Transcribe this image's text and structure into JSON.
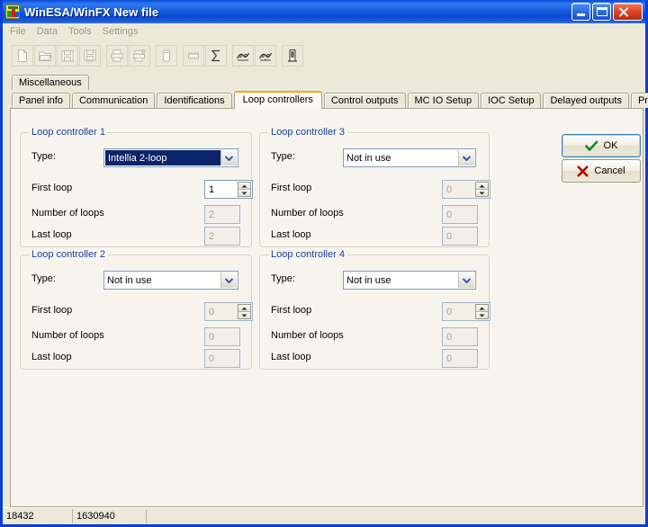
{
  "window": {
    "title": "WinESA/WinFX New file",
    "icon": "app-icon",
    "controls": {
      "minimize": "minimize-button",
      "maximize": "maximize-button",
      "close": "close-button"
    },
    "colors": {
      "titlebar_blue": "#0a49d6",
      "frame_blue": "#0a3fd4",
      "panel_bg": "#f7f4ee",
      "chrome_bg": "#ece9d8",
      "legend_blue": "#1b3f9c",
      "active_tab_accent": "#f5a623",
      "selection_blue": "#0a246a"
    }
  },
  "menubar": {
    "items": [
      {
        "label": "File"
      },
      {
        "label": "Data"
      },
      {
        "label": "Tools"
      },
      {
        "label": "Settings"
      }
    ]
  },
  "toolbar": {
    "buttons": [
      {
        "icon": "new-file-icon",
        "enabled": false
      },
      {
        "icon": "open-folder-icon",
        "enabled": false
      },
      {
        "icon": "save-icon",
        "enabled": false
      },
      {
        "icon": "save-as-icon",
        "enabled": false
      },
      {
        "icon": "print-icon",
        "enabled": false
      },
      {
        "icon": "print-setup-icon",
        "enabled": false
      },
      {
        "icon": "panel-device-icon",
        "enabled": false
      },
      {
        "icon": "keyboard-icon",
        "enabled": false
      },
      {
        "icon": "sigma-sum-icon",
        "enabled": true
      },
      {
        "icon": "loop-network-icon",
        "enabled": true
      },
      {
        "icon": "loop-network-alt-icon",
        "enabled": true
      },
      {
        "icon": "tower-chart-icon",
        "enabled": true
      }
    ]
  },
  "tabs": {
    "row1": [
      {
        "label": "Miscellaneous",
        "active": false
      }
    ],
    "row2": [
      {
        "label": "Panel info",
        "active": false
      },
      {
        "label": "Communication",
        "active": false
      },
      {
        "label": "Identifications",
        "active": false
      },
      {
        "label": "Loop controllers",
        "active": true
      },
      {
        "label": "Control outputs",
        "active": false
      },
      {
        "label": "MC IO Setup",
        "active": false
      },
      {
        "label": "IOC Setup",
        "active": false
      },
      {
        "label": "Delayed outputs",
        "active": false
      },
      {
        "label": "Print and Log",
        "active": false
      }
    ]
  },
  "labels": {
    "type": "Type:",
    "first_loop": "First loop",
    "number_of_loops": "Number of loops",
    "last_loop": "Last loop"
  },
  "groups": [
    {
      "legend": "Loop controller 1",
      "type_value": "Intellia 2-loop",
      "type_selected": true,
      "first_loop": "1",
      "first_loop_enabled": true,
      "number_of_loops": "2",
      "number_of_loops_enabled": false,
      "last_loop": "2",
      "last_loop_enabled": false
    },
    {
      "legend": "Loop controller 3",
      "type_value": "Not in use",
      "type_selected": false,
      "first_loop": "0",
      "first_loop_enabled": false,
      "number_of_loops": "0",
      "number_of_loops_enabled": false,
      "last_loop": "0",
      "last_loop_enabled": false
    },
    {
      "legend": "Loop controller 2",
      "type_value": "Not in use",
      "type_selected": false,
      "first_loop": "0",
      "first_loop_enabled": false,
      "number_of_loops": "0",
      "number_of_loops_enabled": false,
      "last_loop": "0",
      "last_loop_enabled": false
    },
    {
      "legend": "Loop controller 4",
      "type_value": "Not in use",
      "type_selected": false,
      "first_loop": "0",
      "first_loop_enabled": false,
      "number_of_loops": "0",
      "number_of_loops_enabled": false,
      "last_loop": "0",
      "last_loop_enabled": false
    }
  ],
  "buttons": {
    "ok": "OK",
    "cancel": "Cancel"
  },
  "statusbar": {
    "cell1": "18432",
    "cell2": "1630940",
    "cell3": ""
  }
}
